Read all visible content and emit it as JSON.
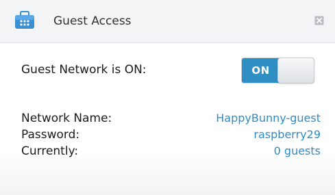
{
  "header": {
    "title": "Guest Access",
    "icon": "guest-access-icon",
    "close_icon": "close-icon"
  },
  "guest_network": {
    "status_label": "Guest Network is ON:",
    "toggle_label": "ON"
  },
  "info": {
    "network_name_label": "Network Name:",
    "network_name_value": "HappyBunny-guest",
    "password_label": "Password:",
    "password_value": "raspberry29",
    "currently_label": "Currently:",
    "currently_value": "0 guests"
  },
  "colors": {
    "accent": "#2f8fc3",
    "link": "#2c8cc8",
    "header_bg": "#f2f4f5"
  }
}
